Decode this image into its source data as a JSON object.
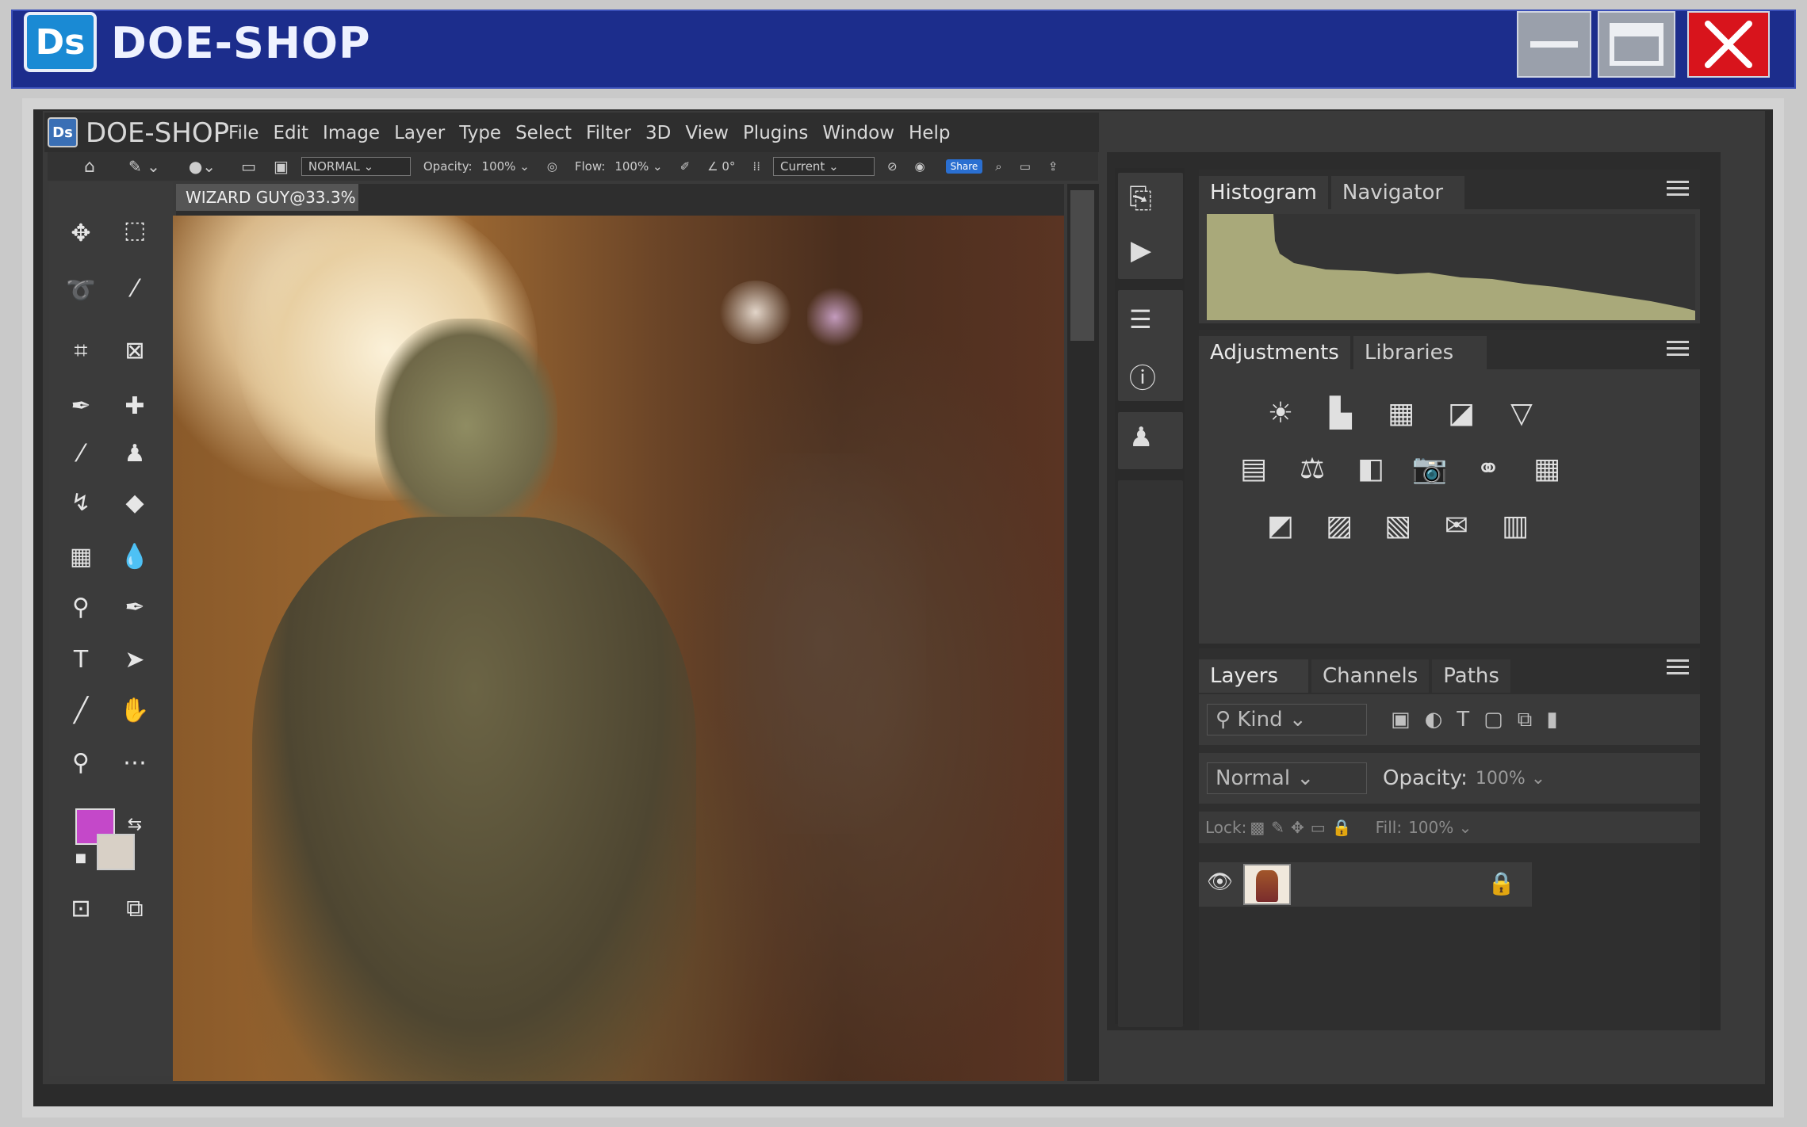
{
  "window": {
    "title": "DOE-SHOP",
    "logo_text": "Ds"
  },
  "app": {
    "logo_text": "Ds",
    "name": "DOE-SHOP",
    "menu": [
      "File",
      "Edit",
      "Image",
      "Layer",
      "Type",
      "Select",
      "Filter",
      "3D",
      "View",
      "Plugins",
      "Window",
      "Help"
    ]
  },
  "options_bar": {
    "blend_mode": "NORMAL",
    "opacity_label": "Opacity:",
    "opacity_value": "100%",
    "flow_label": "Flow:",
    "flow_value": "100%",
    "angle_value": "0°",
    "sample": "Current",
    "share_label": "Share"
  },
  "document": {
    "tab_title": "WIZARD GUY@33.3%"
  },
  "tools": {
    "foreground_color": "#c448c9",
    "background_color": "#d8d0c6"
  },
  "panels": {
    "histogram_tabs": [
      "Histogram",
      "Navigator"
    ],
    "adjustments_tabs": [
      "Adjustments",
      "Libraries"
    ],
    "layers_tabs": [
      "Layers",
      "Channels",
      "Paths"
    ],
    "filter_kind": "Kind",
    "blend_mode": "Normal",
    "opacity_label": "Opacity:",
    "opacity_value": "100%",
    "lock_label": "Lock:",
    "fill_label": "Fill:",
    "fill_value": "100%"
  }
}
